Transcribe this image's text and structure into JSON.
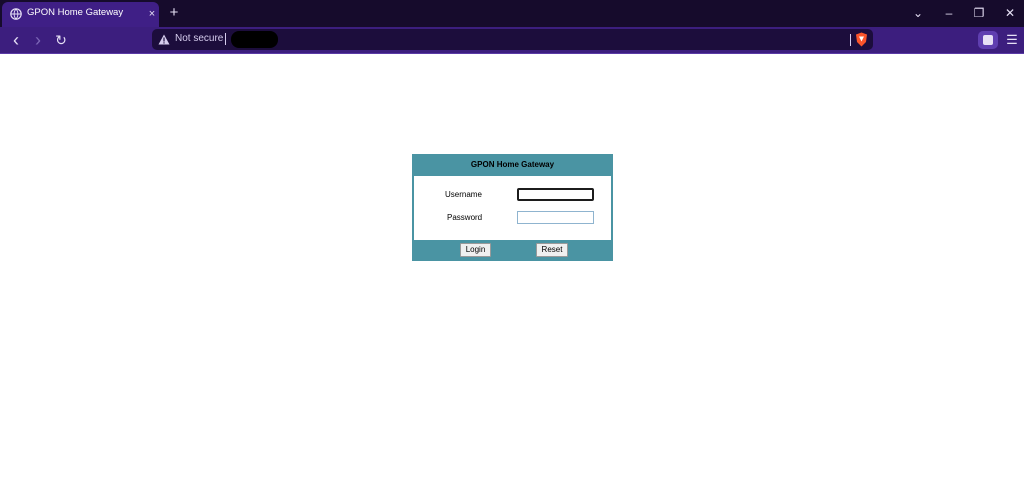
{
  "browser": {
    "tab": {
      "title": "GPON Home Gateway",
      "close_glyph": "×"
    },
    "new_tab_glyph": "+",
    "window_controls": {
      "tabsearch_glyph": "⌄",
      "minimize_glyph": "–",
      "restore_glyph": "❐",
      "close_glyph": "✕"
    },
    "nav": {
      "back_glyph": "‹",
      "forward_glyph": "›",
      "reload_glyph": "↻"
    },
    "address": {
      "security_label": "Not secure",
      "url": ""
    },
    "menu_glyph": "☰",
    "icons": [
      "globe-icon",
      "warning-icon",
      "brave-shield-icon",
      "profile-icon",
      "menu-icon"
    ],
    "colors": {
      "tabstrip": "#160b2c",
      "toolbar": "#3c1e7e",
      "active_tab": "#3f1f86"
    }
  },
  "login": {
    "title": "GPON Home Gateway",
    "username_label": "Username",
    "username_value": "",
    "password_label": "Password",
    "password_value": "",
    "login_label": "Login",
    "reset_label": "Reset",
    "colors": {
      "frame": "#4a94a3",
      "input_border": "#8fb4cf"
    }
  }
}
